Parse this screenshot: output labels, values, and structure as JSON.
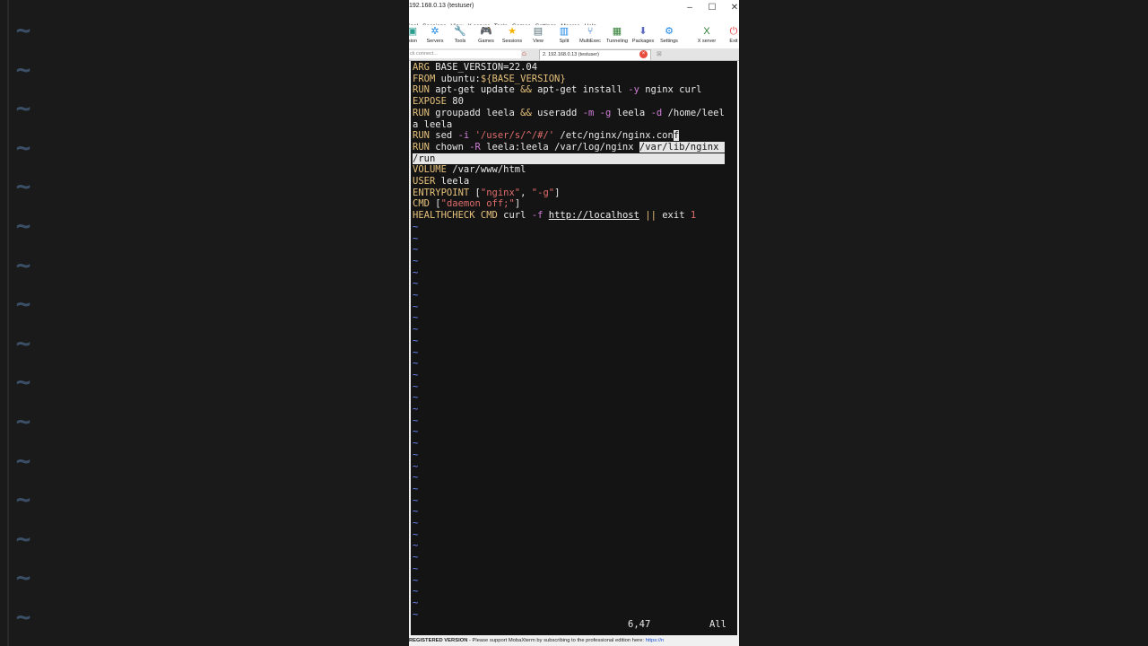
{
  "window": {
    "title": "192.168.0.13 (testuser)",
    "minimize": "–",
    "maximize": "☐",
    "close": "✕"
  },
  "menu": [
    "inal",
    "Sessions",
    "View",
    "X server",
    "Tools",
    "Games",
    "Settings",
    "Macros",
    "Help"
  ],
  "toolbar": [
    {
      "label": "sion",
      "icon": "session-icon",
      "glyph": "▣",
      "color": "#2a9d8f"
    },
    {
      "label": "Servers",
      "icon": "servers-icon",
      "glyph": "✲",
      "color": "#1e88e5"
    },
    {
      "label": "Tools",
      "icon": "tools-icon",
      "glyph": "🔧",
      "color": "#e53935"
    },
    {
      "label": "Games",
      "icon": "games-icon",
      "glyph": "🎮",
      "color": "#555555"
    },
    {
      "label": "Sessions",
      "icon": "sessions-star-icon",
      "glyph": "★",
      "color": "#f4b400"
    },
    {
      "label": "View",
      "icon": "view-icon",
      "glyph": "▤",
      "color": "#546e7a"
    },
    {
      "label": "Split",
      "icon": "split-icon",
      "glyph": "▥",
      "color": "#1e88e5"
    },
    {
      "label": "MultiExec",
      "icon": "multiexec-icon",
      "glyph": "⑂",
      "color": "#1565c0"
    },
    {
      "label": "Tunneling",
      "icon": "tunneling-icon",
      "glyph": "▦",
      "color": "#2e7d32"
    },
    {
      "label": "Packages",
      "icon": "packages-icon",
      "glyph": "⬇",
      "color": "#5c6bc0"
    },
    {
      "label": "Settings",
      "icon": "settings-icon",
      "glyph": "⚙",
      "color": "#1e88e5"
    },
    {
      "label": "X server",
      "icon": "xserver-icon",
      "glyph": "X",
      "color": "#2e7d32"
    },
    {
      "label": "Exit",
      "icon": "exit-icon",
      "glyph": "⏻",
      "color": "#e53935"
    }
  ],
  "quick_connect": {
    "text": "ck connect..."
  },
  "tab": {
    "label": "2. 192.168.0.13 (testuser)",
    "close": "×",
    "new": "⊠"
  },
  "editor": {
    "lines": [
      [
        {
          "t": "ARG",
          "c": "kw"
        },
        {
          "t": " BASE_VERSION=22.04"
        }
      ],
      [
        {
          "t": "FROM",
          "c": "kw"
        },
        {
          "t": " ubuntu:"
        },
        {
          "t": "${BASE_VERSION}",
          "c": "kw"
        }
      ],
      [
        {
          "t": "RUN",
          "c": "kw"
        },
        {
          "t": " apt-get update "
        },
        {
          "t": "&&",
          "c": "op"
        },
        {
          "t": " apt-get install "
        },
        {
          "t": "-y",
          "c": "fl"
        },
        {
          "t": " nginx curl"
        }
      ],
      [
        {
          "t": "EXPOSE",
          "c": "kw"
        },
        {
          "t": " 80"
        }
      ],
      [
        {
          "t": "RUN",
          "c": "kw"
        },
        {
          "t": " groupadd leela "
        },
        {
          "t": "&&",
          "c": "op"
        },
        {
          "t": " useradd "
        },
        {
          "t": "-m",
          "c": "fl"
        },
        {
          "t": " "
        },
        {
          "t": "-g",
          "c": "fl"
        },
        {
          "t": " leela "
        },
        {
          "t": "-d",
          "c": "fl"
        },
        {
          "t": " /home/leel"
        }
      ],
      [
        {
          "t": "a leela"
        }
      ],
      [
        {
          "t": "RUN",
          "c": "kw"
        },
        {
          "t": " sed "
        },
        {
          "t": "-i",
          "c": "fl"
        },
        {
          "t": " "
        },
        {
          "t": "'/user/s/^/#/'",
          "c": "str"
        },
        {
          "t": " /etc/nginx/nginx.con"
        },
        {
          "t": "f",
          "c": "sel"
        }
      ],
      [
        {
          "t": "RUN",
          "c": "kw"
        },
        {
          "t": " chown "
        },
        {
          "t": "-R",
          "c": "fl"
        },
        {
          "t": " leela:leela /var/log/nginx "
        },
        {
          "t": "/var/lib/nginx ",
          "c": "sel"
        }
      ],
      [
        {
          "t": "/run                                                   ",
          "c": "sel"
        }
      ],
      [
        {
          "t": "VOLUME",
          "c": "kw"
        },
        {
          "t": " /var/www/html"
        }
      ],
      [
        {
          "t": "USER",
          "c": "kw"
        },
        {
          "t": " leela"
        }
      ],
      [
        {
          "t": "ENTRYPOINT",
          "c": "kw"
        },
        {
          "t": " ["
        },
        {
          "t": "\"nginx\"",
          "c": "str"
        },
        {
          "t": ", "
        },
        {
          "t": "\"-g\"",
          "c": "str"
        },
        {
          "t": "]"
        }
      ],
      [
        {
          "t": "CMD",
          "c": "kw"
        },
        {
          "t": " ["
        },
        {
          "t": "\"daemon off;\"",
          "c": "str"
        },
        {
          "t": "]"
        }
      ],
      [
        {
          "t": "HEALTHCHECK",
          "c": "kw"
        },
        {
          "t": " "
        },
        {
          "t": "CMD",
          "c": "kw"
        },
        {
          "t": " curl "
        },
        {
          "t": "-f",
          "c": "fl"
        },
        {
          "t": " "
        },
        {
          "t": "http://localhost",
          "c": "url"
        },
        {
          "t": " "
        },
        {
          "t": "||",
          "c": "op"
        },
        {
          "t": " exit "
        },
        {
          "t": "1",
          "c": "num"
        }
      ]
    ],
    "tilde": "~",
    "tilde_rows": 35,
    "cursor_position": "6,47",
    "scroll_indicator": "All"
  },
  "statusbar": {
    "registered": "REGISTERED VERSION",
    "message": " - Please support MobaXterm by subscribing to the professional edition here: ",
    "link": "https://n"
  },
  "background": {
    "tilde_glyph": "~"
  }
}
